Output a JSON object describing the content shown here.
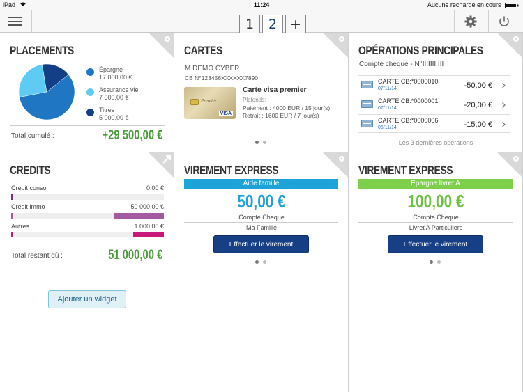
{
  "status_bar": {
    "device": "iPad",
    "time": "11:24",
    "battery_text": "Aucune recharge en cours"
  },
  "toolbar": {
    "tabs": [
      "1",
      "2",
      "+"
    ],
    "active_tab": "2"
  },
  "placements": {
    "title": "PLACEMENTS",
    "items": [
      {
        "name": "Épargne",
        "amount": "17 000,00 €",
        "color": "#1f77c4",
        "value": 17000
      },
      {
        "name": "Assurance vie",
        "amount": "7 500,00 €",
        "color": "#5ecbf5",
        "value": 7500
      },
      {
        "name": "Titres",
        "amount": "5 000,00 €",
        "color": "#123f86",
        "value": 5000
      }
    ],
    "total_label": "Total cumulé :",
    "total_value": "+29 500,00 €"
  },
  "cartes": {
    "title": "CARTES",
    "holder": "M DEMO CYBER",
    "card_number": "CB N°123456XXXXXX7890",
    "card_name": "Carte visa premier",
    "plafonds_label": "Plafonds:",
    "paiement": "Paiement : 4000 EUR / 15 jour(s)",
    "retrait": "Retrait : 1600 EUR / 7 jour(s)",
    "card_brand": "VISA",
    "card_logo_text": "Premier"
  },
  "operations": {
    "title": "OPÉRATIONS PRINCIPALES",
    "account": "Compte cheque - N°IIIIIIIIIII",
    "rows": [
      {
        "label": "CARTE CB:*0000010",
        "date": "07/11/14",
        "amount": "-50,00 €"
      },
      {
        "label": "CARTE CB:*0000001",
        "date": "07/11/14",
        "amount": "-20,00 €"
      },
      {
        "label": "CARTE CB:*0000006",
        "date": "06/11/14",
        "amount": "-15,00 €"
      }
    ],
    "footer": "Les 3 dernières opérations"
  },
  "credits": {
    "title": "CREDITS",
    "items": [
      {
        "name": "Crédit conso",
        "amount": "0,00 €",
        "color": "#7b2f80",
        "fraction": 0
      },
      {
        "name": "Crédit immo",
        "amount": "50 000,00 €",
        "color": "#a35aa0",
        "fraction": 0.33
      },
      {
        "name": "Autres",
        "amount": "1 000,00 €",
        "color": "#c8187a",
        "fraction": 0.2
      }
    ],
    "total_label": "Total restant dû :",
    "total_value": "51 000,00 €"
  },
  "virement1": {
    "title": "VIREMENT EXPRESS",
    "band": "Aide famille",
    "band_color": "#1ea3d9",
    "amount": "50,00 €",
    "amount_color": "#1ea3d9",
    "from": "Compte Cheque",
    "to": "Ma Famille",
    "button": "Effectuer le virement"
  },
  "virement2": {
    "title": "VIREMENT EXPRESS",
    "band": "Epargne livret A",
    "band_color": "#7ed04b",
    "amount": "100,00 €",
    "amount_color": "#6cc23f",
    "from": "Compte Cheque",
    "to": "Livret A Particuliers",
    "button": "Effectuer le virement"
  },
  "add_widget": {
    "label": "Ajouter un widget"
  }
}
